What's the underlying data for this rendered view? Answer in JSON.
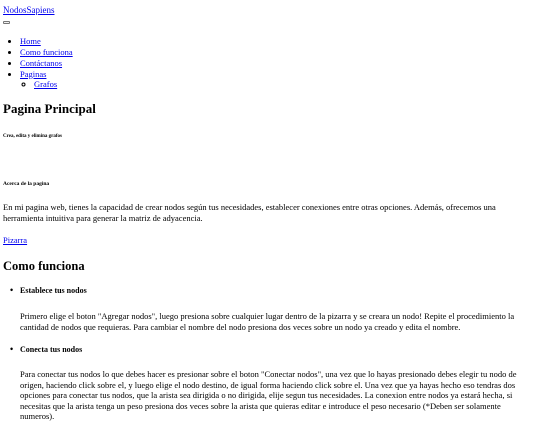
{
  "navbar": {
    "brand": "NodosSapiens",
    "items": [
      {
        "label": "Home"
      },
      {
        "label": "Como funciona"
      },
      {
        "label": "Contáctanos"
      },
      {
        "label": "Paginas"
      }
    ],
    "subitems": [
      {
        "label": "Grafos"
      }
    ]
  },
  "hero": {
    "title": "Pagina Principal",
    "subtitle": "Crea, edita y elimina grafos"
  },
  "about": {
    "heading": "Acerca de la pagina",
    "paragraph": "En mi pagina web, tienes la capacidad de crear nodos según tus necesidades, establecer conexiones entre otras opciones. Además, ofrecemos una herramienta intuitiva para generar la matriz de adyacencia.",
    "link": "Pizarra"
  },
  "how": {
    "heading": "Como funciona",
    "items": [
      {
        "title": "Establece tus nodos",
        "text": "Primero elige el boton \"Agregar nodos\", luego presiona sobre cualquier lugar dentro de la pizarra y se creara un nodo! Repite el procedimiento la cantidad de nodos que requieras. Para cambiar el nombre del nodo presiona dos veces sobre un nodo ya creado y edita el nombre."
      },
      {
        "title": "Conecta tus nodos",
        "text": "Para conectar tus nodos lo que debes hacer es presionar sobre el boton \"Conectar nodos\", una vez que lo hayas presionado debes elegir tu nodo de origen, haciendo click sobre el, y luego elige el nodo destino, de igual forma haciendo click sobre el. Una vez que ya hayas hecho eso tendras dos opciones para conectar tus nodos, que la arista sea dirigida o no dirigida, elije segun tus necesidades. La conexion entre nodos ya estará hecha, si necesitas que la arista tenga un peso presiona dos veces sobre la arista que quieras editar e introduce el peso necesario (*Deben ser solamente numeros)."
      }
    ]
  }
}
